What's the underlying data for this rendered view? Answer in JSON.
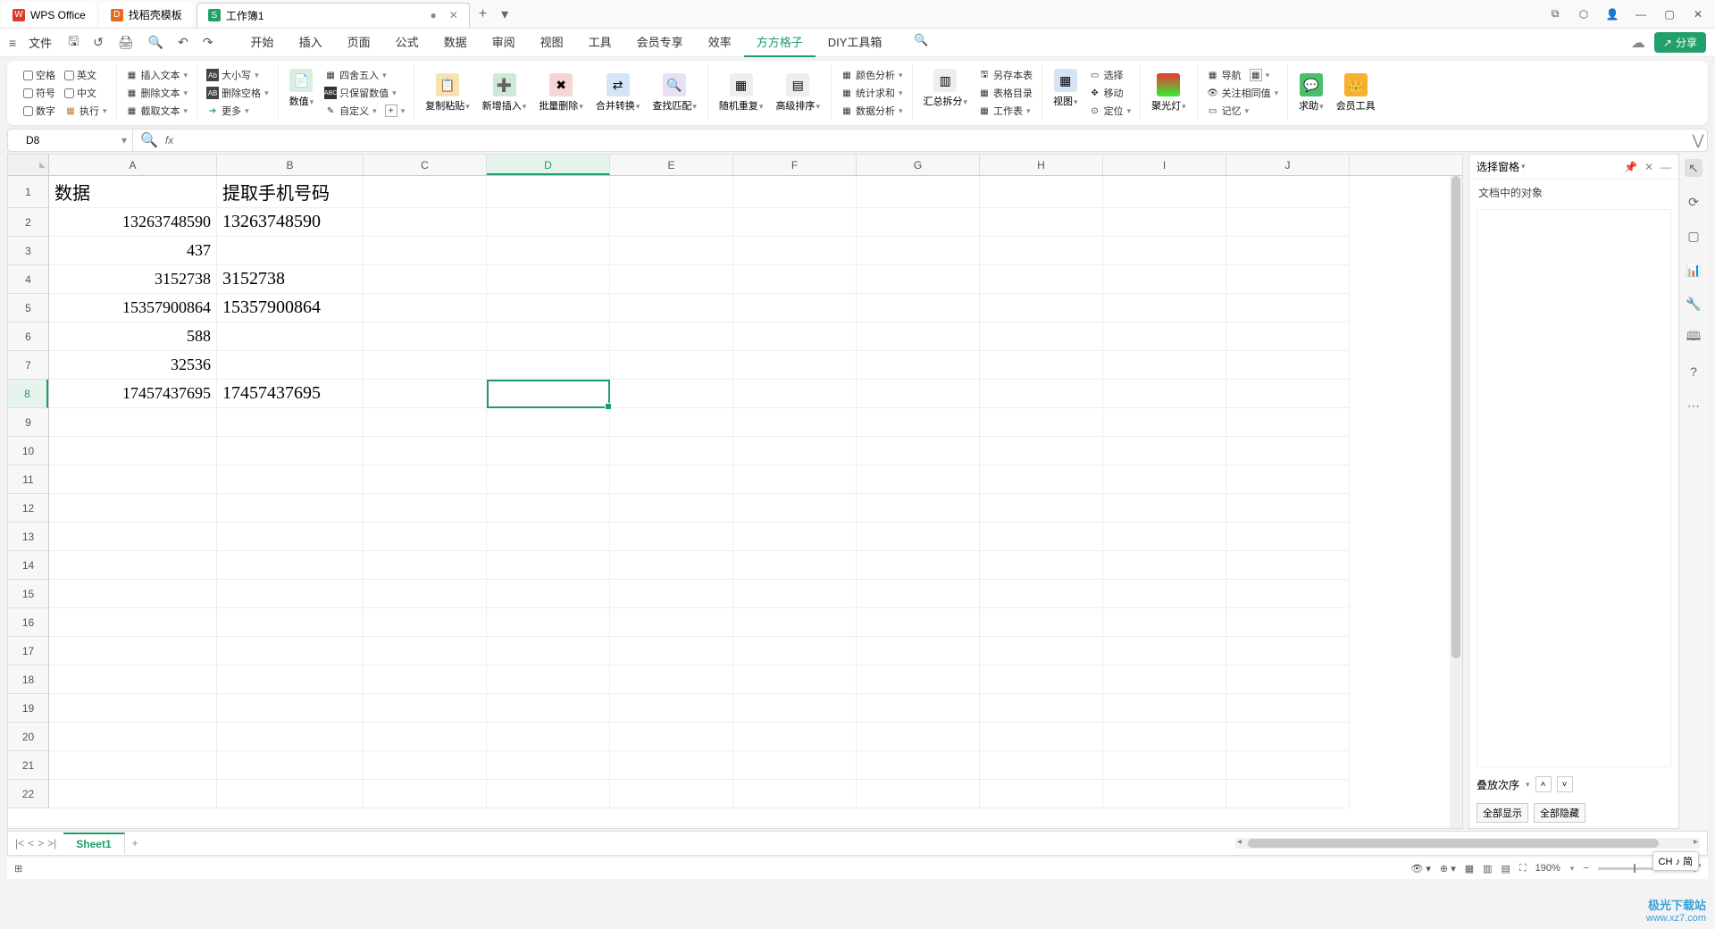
{
  "titlebar": {
    "tab_wps": "WPS Office",
    "tab_template": "找稻壳模板",
    "tab_workbook": "工作簿1"
  },
  "menubar": {
    "file": "文件",
    "tabs": [
      "开始",
      "插入",
      "页面",
      "公式",
      "数据",
      "审阅",
      "视图",
      "工具",
      "会员专享",
      "效率",
      "方方格子",
      "DIY工具箱"
    ],
    "active_tab": "方方格子",
    "share": "分享"
  },
  "ribbon": {
    "g1": {
      "blank": "空格",
      "english": "英文",
      "symbol": "符号",
      "chinese": "中文",
      "number": "数字",
      "execute": "执行"
    },
    "g2": {
      "insert_text": "插入文本",
      "delete_text": "删除文本",
      "extract_text": "截取文本"
    },
    "g3": {
      "case": "大小写",
      "del_blank": "删除空格",
      "more": "更多"
    },
    "g4": {
      "value": "数值",
      "round": "四舍五入",
      "keep_num": "只保留数值",
      "custom": "自定义"
    },
    "g5": {
      "copy_paste": "复制粘贴",
      "insert_n": "新增插入",
      "batch_del": "批量删除",
      "merge_convert": "合并转换",
      "find_match": "查找匹配"
    },
    "g6": {
      "random": "随机重复",
      "adv_sort": "高级排序"
    },
    "g7": {
      "color_analysis": "颜色分析",
      "stat_sum": "统计求和",
      "data_analysis": "数据分析"
    },
    "g8": {
      "split": "汇总拆分",
      "save_as": "另存本表",
      "book_toc": "表格目录",
      "worksheet": "工作表"
    },
    "g9": {
      "view": "视图",
      "select": "选择",
      "move": "移动",
      "locate": "定位"
    },
    "g10": {
      "spotlight": "聚光灯"
    },
    "g11": {
      "nav": "导航",
      "watch_same": "关注相同值",
      "memory": "记忆"
    },
    "g12": {
      "help": "求助",
      "member_tools": "会员工具"
    }
  },
  "formula_bar": {
    "name_box": "D8",
    "fx": "fx"
  },
  "columns": [
    "A",
    "B",
    "C",
    "D",
    "E",
    "F",
    "G",
    "H",
    "I",
    "J"
  ],
  "active_col": "D",
  "active_row": 8,
  "row_count": 22,
  "cells": {
    "A1": "数据",
    "B1": "提取手机号码",
    "A2": "13263748590",
    "B2": "13263748590",
    "A3": "437",
    "A4": "3152738",
    "B4": "3152738",
    "A5": "15357900864",
    "B5": "15357900864",
    "A6": "588",
    "A7": "32536",
    "A8": "17457437695",
    "B8": "17457437695"
  },
  "side_panel": {
    "title": "选择窗格",
    "subtitle": "文档中的对象",
    "stack_order": "叠放次序",
    "show_all": "全部显示",
    "hide_all": "全部隐藏"
  },
  "sheet_tabs": {
    "sheet1": "Sheet1"
  },
  "statusbar": {
    "zoom": "190%"
  },
  "ime": "CH ♪ 简",
  "watermark": {
    "l1": "极光下载站",
    "l2": "www.xz7.com"
  }
}
